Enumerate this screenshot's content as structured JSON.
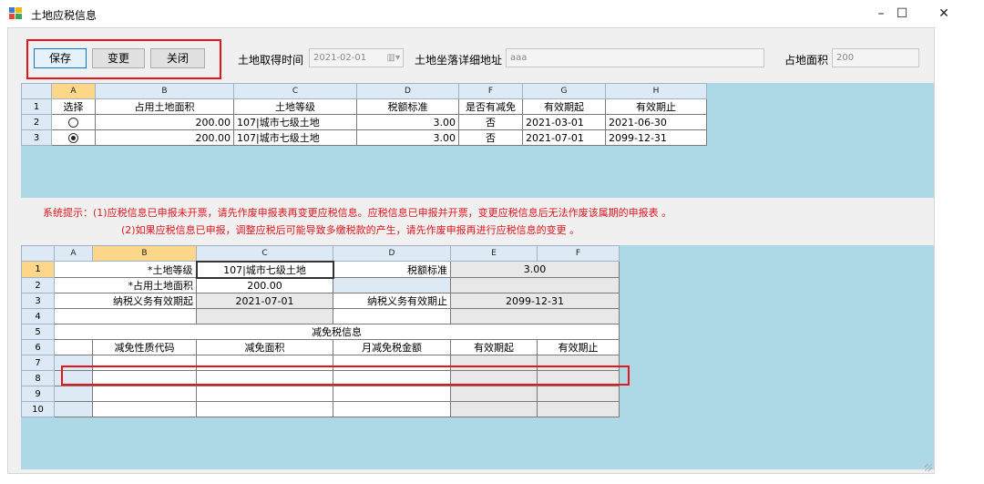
{
  "window": {
    "title": "土地应税信息",
    "minimize": "–",
    "maximize": "☐",
    "close": "✕"
  },
  "toolbar": {
    "save": "保存",
    "change": "变更",
    "close": "关闭"
  },
  "form": {
    "acquire_time_label": "土地取得时间",
    "acquire_time_value": "2021-02-01",
    "address_label": "土地坐落详细地址",
    "address_value": "aaa",
    "area_label": "占地面积",
    "area_value": "200"
  },
  "top_grid": {
    "col_letters": [
      "A",
      "B",
      "C",
      "D",
      "F",
      "G",
      "H"
    ],
    "headers": [
      "选择",
      "占用土地面积",
      "土地等级",
      "税额标准",
      "是否有减免",
      "有效期起",
      "有效期止"
    ],
    "rows": [
      {
        "num": "2",
        "selected": false,
        "area": "200.00",
        "grade": "107|城市七级土地",
        "rate": "3.00",
        "reduce": "否",
        "start": "2021-03-01",
        "end": "2021-06-30"
      },
      {
        "num": "3",
        "selected": true,
        "area": "200.00",
        "grade": "107|城市七级土地",
        "rate": "3.00",
        "reduce": "否",
        "start": "2021-07-01",
        "end": "2099-12-31"
      }
    ]
  },
  "hints": {
    "line1": "系统提示：(1)应税信息已申报未开票，请先作废申报表再变更应税信息。应税信息已申报并开票，变更应税信息后无法作废该属期的申报表 。",
    "line2": "(2)如果应税信息已申报，调整应税后可能导致多缴税款的产生，请先作废申报再进行应税信息的变更 。"
  },
  "bottom_grid": {
    "col_letters": [
      "A",
      "B",
      "C",
      "D",
      "E",
      "F"
    ],
    "row_nums": [
      "1",
      "2",
      "3",
      "4",
      "5",
      "6",
      "7",
      "8",
      "9",
      "10"
    ],
    "r1": {
      "label1": "*土地等级",
      "value1": "107|城市七级土地",
      "label2": "税额标准",
      "value2": "3.00"
    },
    "r2": {
      "label1": "*占用土地面积",
      "value1": "200.00"
    },
    "r3": {
      "label1": "纳税义务有效期起",
      "value1": "2021-07-01",
      "label2": "纳税义务有效期止",
      "value2": "2099-12-31"
    },
    "section_title": "减免税信息",
    "sub_headers": [
      "减免性质代码",
      "减免面积",
      "月减免税金额",
      "有效期起",
      "有效期止"
    ]
  }
}
